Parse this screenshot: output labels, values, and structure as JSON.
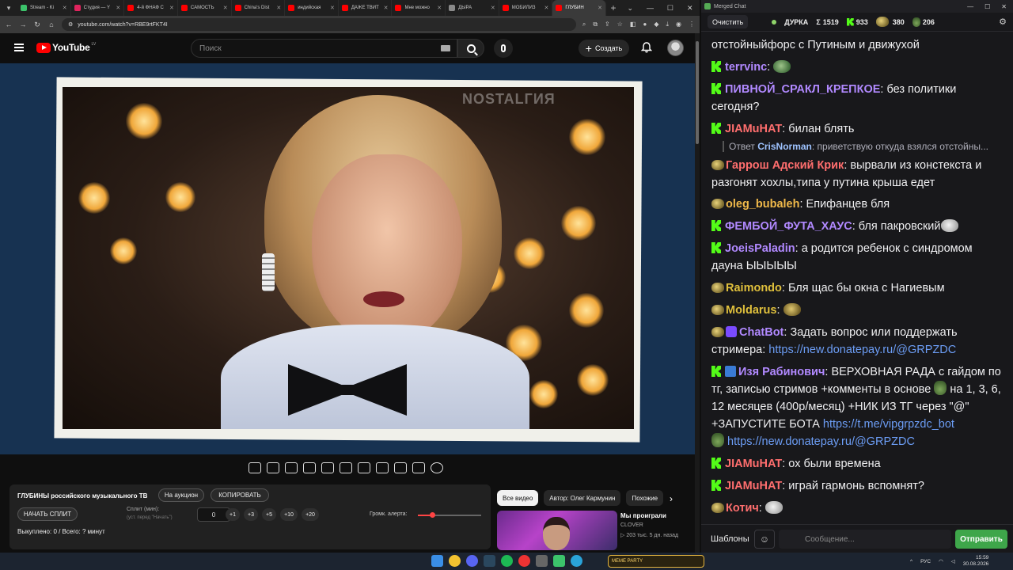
{
  "browser": {
    "tabs": [
      {
        "title": "Stream - Ki",
        "color": "#3cc36b"
      },
      {
        "title": "Студия — Y",
        "color": "#e0245e"
      },
      {
        "title": "4-й ФНАФ С",
        "color": "#ff0000"
      },
      {
        "title": "САМОСТЬ",
        "color": "#ff0000"
      },
      {
        "title": "China's Dist",
        "color": "#ff0000"
      },
      {
        "title": "индийская",
        "color": "#ff0000"
      },
      {
        "title": "ДАЖЕ ТВИТ",
        "color": "#ff0000"
      },
      {
        "title": "Мне можно",
        "color": "#ff0000"
      },
      {
        "title": "ДЫРА",
        "color": "#8a8a8a"
      },
      {
        "title": "МОБИЛИЗ",
        "color": "#ff0000"
      },
      {
        "title": "ГЛУБИН",
        "color": "#ff0000",
        "active": true
      }
    ],
    "url": "youtube.com/watch?v=RBE9rtFKT4I"
  },
  "youtube": {
    "logo_text": "YouTube",
    "country_code": "LV",
    "search_placeholder": "Поиск",
    "create_label": "Создать",
    "watermark": "NOSTALГИЯ"
  },
  "panel": {
    "title": "ГЛУБИНЫ российского музыкального ТВ",
    "auction_label": "На аукцион",
    "copy_label": "КОПИРОВАТЬ",
    "start_split_label": "НАЧАТЬ СПЛИТ",
    "split_label": "Сплит (мин):",
    "split_hint": "(уст. перед \"Начать\")",
    "split_value": "0",
    "increments": [
      "+1",
      "+3",
      "+5",
      "+10",
      "+20"
    ],
    "volume_label": "Громк. алерта:",
    "volume_level": 0.23,
    "status": "Выкуплено: 0 / Всего: ? минут"
  },
  "recommendations": {
    "chips": [
      "Все видео",
      "Автор: Олег Кармунин",
      "Похожие"
    ],
    "video": {
      "title": "Мы проиграли",
      "channel": "CLOVER",
      "meta": "▷ 203 тыс.  5 дн. назад"
    }
  },
  "chat": {
    "window_title": "Merged Chat",
    "clear_label": "Очистить",
    "channel_name": "ДУРКА",
    "stats": {
      "sigma": "1519",
      "kick": "933",
      "emote": "380",
      "other": "206"
    },
    "messages": [
      {
        "badge": "none",
        "user": "",
        "color": "#efeff1",
        "text": "отстойныйфорс с Путиным и движухой"
      },
      {
        "badge": "kick",
        "user": "terrvinc",
        "color": "#b189ff",
        "text": " ",
        "emote": "green"
      },
      {
        "badge": "kick",
        "user": "ПИВНОЙ_СРАКЛ_КРЕПКОЕ",
        "color": "#b189ff",
        "text": "без политики сегодня?"
      },
      {
        "badge": "kick",
        "user": "JIAMuHAT",
        "color": "#ff6e6e",
        "text": "билан блять"
      },
      {
        "badge": "emote",
        "user": "Гаррош Адский Крик",
        "color": "#ff6e6e",
        "text": "вырвали из констекста и разгонят хохлы,типа  у путина крыша едет"
      },
      {
        "badge": "emote",
        "user": "oleg_bubaleh",
        "color": "#f0b94a",
        "text": "Епифанцев бля"
      },
      {
        "badge": "kick",
        "user": "ФЕМБОЙ_ФУТА_ХАУС",
        "color": "#b189ff",
        "text": "бля пакровский",
        "emote": "gray"
      },
      {
        "badge": "kick",
        "user": "JoeisPaladin",
        "color": "#b189ff",
        "text": "а родится ребенок с синдромом дауна ЫЫЫЫЫ"
      },
      {
        "badge": "emote",
        "user": "Raimondo",
        "color": "#e0c03c",
        "text": "Бля щас бы окна с Нагиевым"
      },
      {
        "badge": "emote",
        "user": "Moldarus",
        "color": "#e0c03c",
        "text": " ",
        "emote": "gold"
      },
      {
        "badge": "emote",
        "user": "ChatBot",
        "color": "#b189ff",
        "text": "Задать вопрос или поддержать стримера: ",
        "link": "https://new.donatepay.ru/@GRPZDC"
      },
      {
        "badge": "kick",
        "user": "Изя Рабинович",
        "color": "#b189ff",
        "text": "ВЕРХОВНАЯ РАДА с гайдом по тг, записью стримов +комменты в основе",
        "text2": "на 1, 3, 6, 12 месяцев (400р/месяц) +НИК ИЗ ТГ через \"@\" +ЗАПУСТИТЕ БОТА ",
        "link": "https://t.me/vipgrpzdc_bot",
        "link2": "https://new.donatepay.ru/@GRPZDC"
      },
      {
        "badge": "kick",
        "user": "JIAMuHAT",
        "color": "#ff6e6e",
        "text": "ох были времена"
      },
      {
        "badge": "kick",
        "user": "JIAMuHAT",
        "color": "#ff6e6e",
        "text": "играй гармонь вспомнят?"
      },
      {
        "badge": "emote",
        "user": "Котич",
        "color": "#ff6e6e",
        "text": " ",
        "emote": "gray"
      }
    ],
    "reply": {
      "prefix": "Ответ",
      "user": "CrisNorman",
      "text": "приветствую откуда взялся отстойны..."
    },
    "templates_label": "Шаблоны",
    "input_placeholder": "Сообщение...",
    "send_label": "Отправить"
  },
  "taskbar": {
    "widget_text": "MEME PARTY",
    "lang": "РУС",
    "time": "15:59",
    "date": "30.08.2026"
  }
}
